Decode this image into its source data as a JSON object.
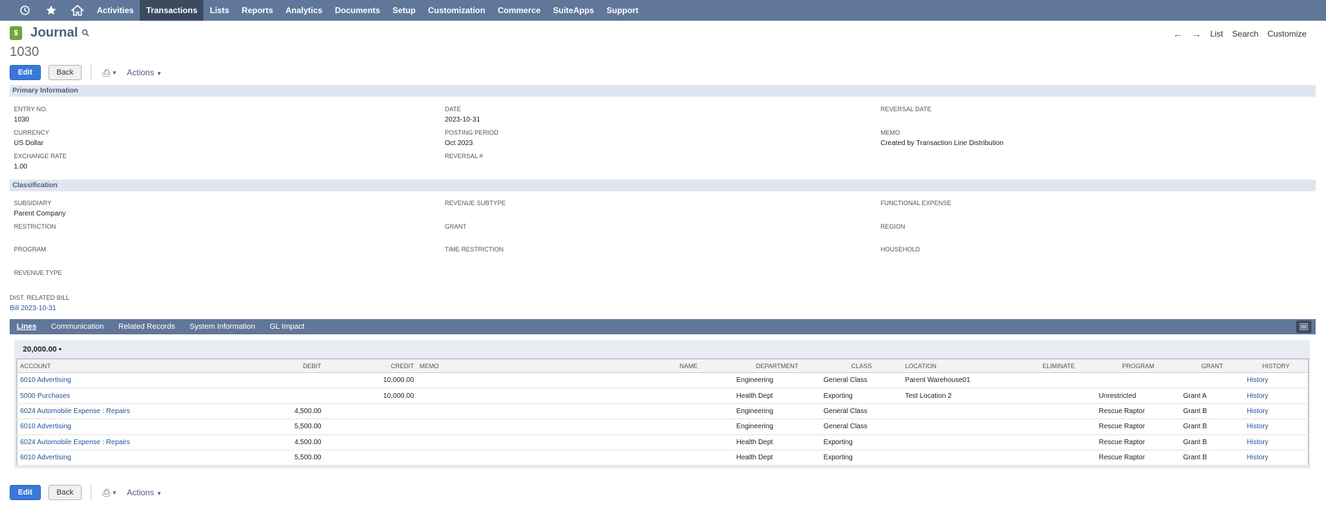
{
  "nav": {
    "icons": [
      "recent-records-icon",
      "star-icon",
      "home-icon"
    ],
    "items": [
      "Activities",
      "Transactions",
      "Lists",
      "Reports",
      "Analytics",
      "Documents",
      "Setup",
      "Customization",
      "Commerce",
      "SuiteApps",
      "Support"
    ],
    "active": "Transactions"
  },
  "header": {
    "title": "Journal",
    "record_number": "1030",
    "right_links": {
      "list": "List",
      "search": "Search",
      "customize": "Customize"
    }
  },
  "buttons": {
    "edit": "Edit",
    "back": "Back",
    "actions": "Actions"
  },
  "primary": {
    "title": "Primary Information",
    "entry_no": {
      "label": "ENTRY NO.",
      "value": "1030"
    },
    "date": {
      "label": "DATE",
      "value": "2023-10-31"
    },
    "reversal_date": {
      "label": "REVERSAL DATE",
      "value": ""
    },
    "currency": {
      "label": "CURRENCY",
      "value": "US Dollar"
    },
    "posting_period": {
      "label": "POSTING PERIOD",
      "value": "Oct 2023"
    },
    "memo": {
      "label": "MEMO",
      "value": "Created by Transaction Line Distribution"
    },
    "exchange_rate": {
      "label": "EXCHANGE RATE",
      "value": "1.00"
    },
    "reversal_no": {
      "label": "REVERSAL #",
      "value": ""
    }
  },
  "classification": {
    "title": "Classification",
    "subsidiary": {
      "label": "SUBSIDIARY",
      "value": "Parent Company"
    },
    "revenue_subtype": {
      "label": "REVENUE SUBTYPE",
      "value": ""
    },
    "functional_expense": {
      "label": "FUNCTIONAL EXPENSE",
      "value": ""
    },
    "restriction": {
      "label": "RESTRICTION",
      "value": ""
    },
    "grant": {
      "label": "GRANT",
      "value": ""
    },
    "region": {
      "label": "REGION",
      "value": ""
    },
    "program": {
      "label": "PROGRAM",
      "value": ""
    },
    "time_restriction": {
      "label": "TIME RESTRICTION",
      "value": ""
    },
    "household": {
      "label": "HOUSEHOLD",
      "value": ""
    },
    "revenue_type": {
      "label": "REVENUE TYPE",
      "value": ""
    }
  },
  "dist_related_bill": {
    "label": "DIST. RELATED BILL",
    "value": "Bill 2023-10-31"
  },
  "subtabs": [
    "Lines",
    "Communication",
    "Related Records",
    "System Information",
    "GL Impact"
  ],
  "lines": {
    "total": "20,000.00",
    "columns": [
      "ACCOUNT",
      "DEBIT",
      "CREDIT",
      "MEMO",
      "NAME",
      "DEPARTMENT",
      "CLASS",
      "LOCATION",
      "ELIMINATE",
      "PROGRAM",
      "GRANT",
      "HISTORY"
    ],
    "rows": [
      [
        "6010 Advertising",
        "",
        "10,000.00",
        "",
        "",
        "Engineering",
        "General Class",
        "Parent Warehouse01",
        "",
        "",
        "",
        "History"
      ],
      [
        "5000 Purchases",
        "",
        "10,000.00",
        "",
        "",
        "Health Dept",
        "Exporting",
        "Test Location 2",
        "",
        "Unrestricted",
        "Grant A",
        "History"
      ],
      [
        "6024 Automobile Expense : Repairs",
        "4,500.00",
        "",
        "",
        "",
        "Engineering",
        "General Class",
        "",
        "",
        "Rescue Raptor",
        "Grant B",
        "History"
      ],
      [
        "6010 Advertising",
        "5,500.00",
        "",
        "",
        "",
        "Engineering",
        "General Class",
        "",
        "",
        "Rescue Raptor",
        "Grant B",
        "History"
      ],
      [
        "6024 Automobile Expense : Repairs",
        "4,500.00",
        "",
        "",
        "",
        "Health Dept",
        "Exporting",
        "",
        "",
        "Rescue Raptor",
        "Grant B",
        "History"
      ],
      [
        "6010 Advertising",
        "5,500.00",
        "",
        "",
        "",
        "Health Dept",
        "Exporting",
        "",
        "",
        "Rescue Raptor",
        "Grant B",
        "History"
      ]
    ]
  },
  "colors": {
    "nav_bg": "#607799",
    "nav_active": "#3c4a60",
    "primary_button": "#3a78d8",
    "link": "#255599",
    "section_bg": "#e0e6ef"
  }
}
